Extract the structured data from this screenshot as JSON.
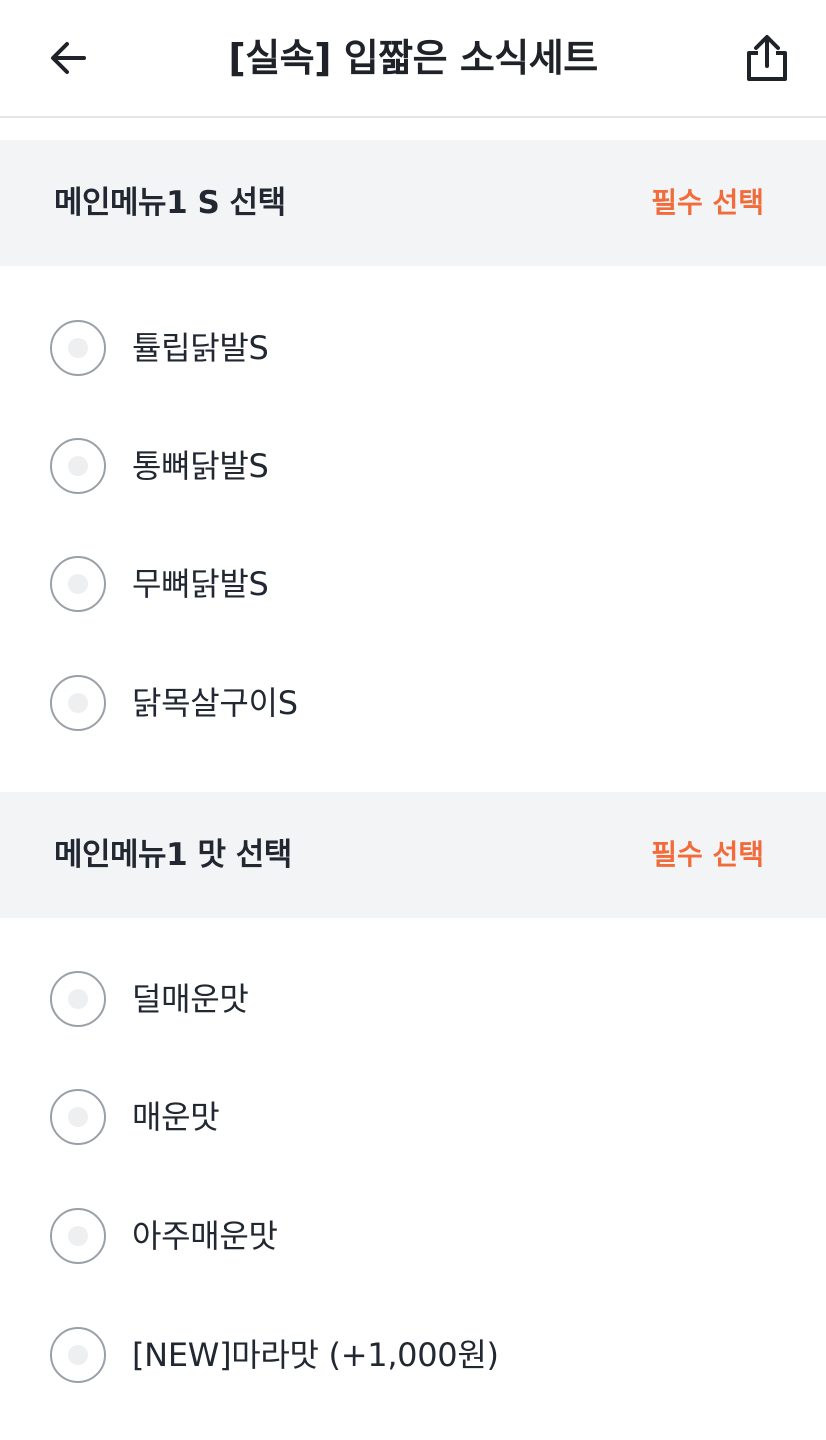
{
  "header": {
    "title": "[실속] 입짧은 소식세트",
    "back_icon": "arrow-left-icon",
    "share_icon": "share-icon"
  },
  "sections": [
    {
      "title": "메인메뉴1 S 선택",
      "badge": "필수 선택",
      "options": [
        {
          "label": "튤립닭발S"
        },
        {
          "label": "통뼈닭발S"
        },
        {
          "label": "무뼈닭발S"
        },
        {
          "label": "닭목살구이S"
        }
      ]
    },
    {
      "title": "메인메뉴1 맛 선택",
      "badge": "필수 선택",
      "options": [
        {
          "label": "덜매운맛"
        },
        {
          "label": "매운맛"
        },
        {
          "label": "아주매운맛"
        },
        {
          "label": "[NEW]마라맛 (+1,000원)"
        }
      ]
    }
  ],
  "colors": {
    "accent": "#f26b3a",
    "section_bg": "#f3f4f6",
    "text": "#222831",
    "radio_border": "#9aa0a8"
  }
}
